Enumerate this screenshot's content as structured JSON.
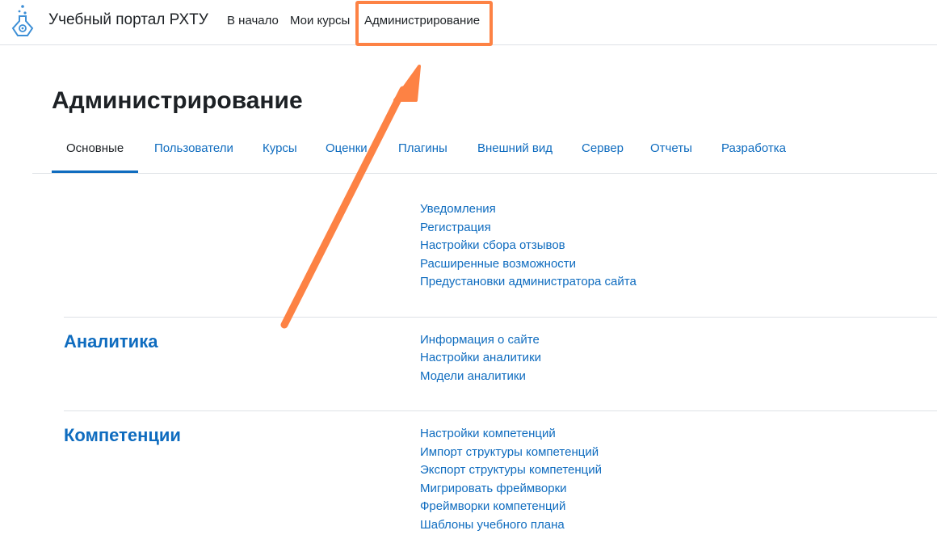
{
  "header": {
    "site_name": "Учебный портал РХТУ",
    "nav": [
      "В начало",
      "Мои курсы",
      "Администрирование"
    ]
  },
  "page": {
    "title": "Администрирование",
    "tabs": [
      "Основные",
      "Пользователи",
      "Курсы",
      "Оценки",
      "Плагины",
      "Внешний вид",
      "Сервер",
      "Отчеты",
      "Разработка"
    ],
    "active_tab": "Основные"
  },
  "sections": {
    "general": {
      "links": [
        "Уведомления",
        "Регистрация",
        "Настройки сбора отзывов",
        "Расширенные возможности",
        "Предустановки администратора сайта"
      ]
    },
    "analytics": {
      "title": "Аналитика",
      "links": [
        "Информация о сайте",
        "Настройки аналитики",
        "Модели аналитики"
      ]
    },
    "competencies": {
      "title": "Компетенции",
      "links": [
        "Настройки компетенций",
        "Импорт структуры компетенций",
        "Экспорт структуры компетенций",
        "Мигрировать фреймворки",
        "Фреймворки компетенций",
        "Шаблоны учебного плана"
      ]
    }
  },
  "colors": {
    "link": "#0f6cbf",
    "annotation": "#fd8244"
  }
}
